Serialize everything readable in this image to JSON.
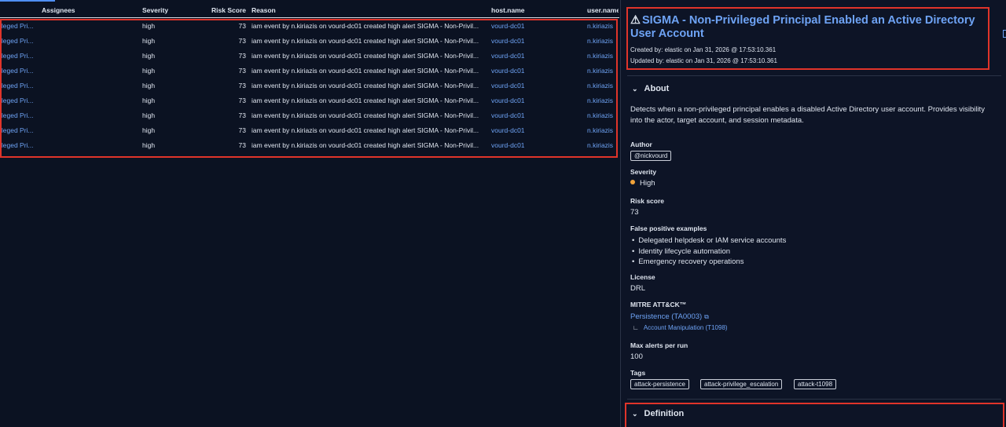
{
  "table": {
    "columns": {
      "assignees": "Assignees",
      "severity": "Severity",
      "risk_score": "Risk Score",
      "reason": "Reason",
      "host_name": "host.name",
      "user_name": "user.name"
    },
    "rows": [
      {
        "rule": "ileged Pri...",
        "severity": "high",
        "risk": "73",
        "reason": "iam event by n.kiriazis on vourd-dc01 created high alert SIGMA - Non-Privil...",
        "host": "vourd-dc01",
        "user": "n.kiriazis"
      },
      {
        "rule": "ileged Pri...",
        "severity": "high",
        "risk": "73",
        "reason": "iam event by n.kiriazis on vourd-dc01 created high alert SIGMA - Non-Privil...",
        "host": "vourd-dc01",
        "user": "n.kiriazis"
      },
      {
        "rule": "ileged Pri...",
        "severity": "high",
        "risk": "73",
        "reason": "iam event by n.kiriazis on vourd-dc01 created high alert SIGMA - Non-Privil...",
        "host": "vourd-dc01",
        "user": "n.kiriazis"
      },
      {
        "rule": "ileged Pri...",
        "severity": "high",
        "risk": "73",
        "reason": "iam event by n.kiriazis on vourd-dc01 created high alert SIGMA - Non-Privil...",
        "host": "vourd-dc01",
        "user": "n.kiriazis"
      },
      {
        "rule": "ileged Pri...",
        "severity": "high",
        "risk": "73",
        "reason": "iam event by n.kiriazis on vourd-dc01 created high alert SIGMA - Non-Privil...",
        "host": "vourd-dc01",
        "user": "n.kiriazis"
      },
      {
        "rule": "ileged Pri...",
        "severity": "high",
        "risk": "73",
        "reason": "iam event by n.kiriazis on vourd-dc01 created high alert SIGMA - Non-Privil...",
        "host": "vourd-dc01",
        "user": "n.kiriazis"
      },
      {
        "rule": "ileged Pri...",
        "severity": "high",
        "risk": "73",
        "reason": "iam event by n.kiriazis on vourd-dc01 created high alert SIGMA - Non-Privil...",
        "host": "vourd-dc01",
        "user": "n.kiriazis"
      },
      {
        "rule": "ileged Pri...",
        "severity": "high",
        "risk": "73",
        "reason": "iam event by n.kiriazis on vourd-dc01 created high alert SIGMA - Non-Privil...",
        "host": "vourd-dc01",
        "user": "n.kiriazis"
      },
      {
        "rule": "ileged Pri...",
        "severity": "high",
        "risk": "73",
        "reason": "iam event by n.kiriazis on vourd-dc01 created high alert SIGMA - Non-Privil...",
        "host": "vourd-dc01",
        "user": "n.kiriazis"
      }
    ]
  },
  "flyout": {
    "warning_icon": "⚠",
    "title": "SIGMA - Non-Privileged Principal Enabled an Active Directory User Account",
    "created": "Created by: elastic on Jan 31, 2026 @ 17:53:10.361",
    "updated": "Updated by: elastic on Jan 31, 2026 @ 17:53:10.361",
    "about": {
      "heading": "About",
      "description": "Detects when a non-privileged principal enables a disabled Active Directory user account. Provides visibility into the actor, target account, and session metadata.",
      "author_label": "Author",
      "author": "@nickvourd",
      "severity_label": "Severity",
      "severity": "High",
      "risk_label": "Risk score",
      "risk": "73",
      "fp_label": "False positive examples",
      "fp": [
        "Delegated helpdesk or IAM service accounts",
        "Identity lifecycle automation",
        "Emergency recovery operations"
      ],
      "license_label": "License",
      "license": "DRL",
      "mitre_label": "MITRE ATT&CK™",
      "mitre_tactic": "Persistence (TA0003)",
      "mitre_technique": "Account Manipulation (T1098)",
      "max_alerts_label": "Max alerts per run",
      "max_alerts": "100",
      "tags_label": "Tags",
      "tags": [
        "attack-persistence",
        "attack-privilege_escalation",
        "attack-t1098"
      ]
    },
    "definition": {
      "heading": "Definition"
    }
  },
  "colors": {
    "accent": "#6ea3f5",
    "highlight": "#e0342a",
    "severity_high": "#f0a23a",
    "background": "#0b1222"
  }
}
